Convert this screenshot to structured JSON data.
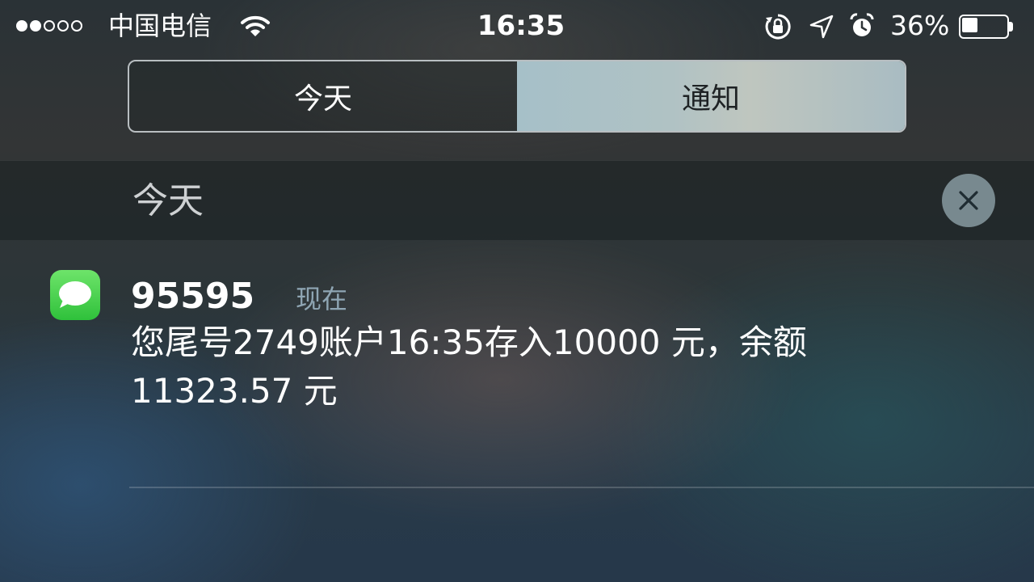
{
  "status_bar": {
    "signal_bars_total": 5,
    "signal_bars_filled": 2,
    "carrier": "中国电信",
    "time": "16:35",
    "battery_percent_text": "36%",
    "battery_level": 0.36,
    "icons": [
      "wifi-icon",
      "rotation-lock-icon",
      "location-arrow-icon",
      "alarm-clock-icon",
      "battery-icon"
    ]
  },
  "tabs": [
    {
      "label": "今天",
      "selected": false
    },
    {
      "label": "通知",
      "selected": true
    }
  ],
  "section": {
    "title": "今天",
    "clear_icon": "close-icon"
  },
  "notification": {
    "app_icon": "messages-icon",
    "sender": "95595",
    "time": "现在",
    "message": "您尾号2749账户16:35存入10000 元，余额\n11323.57 元"
  },
  "colors": {
    "accent_green": "#3fd04a",
    "selected_tab": "#b0c2c4",
    "secondary_text": "#8fa6b4"
  }
}
